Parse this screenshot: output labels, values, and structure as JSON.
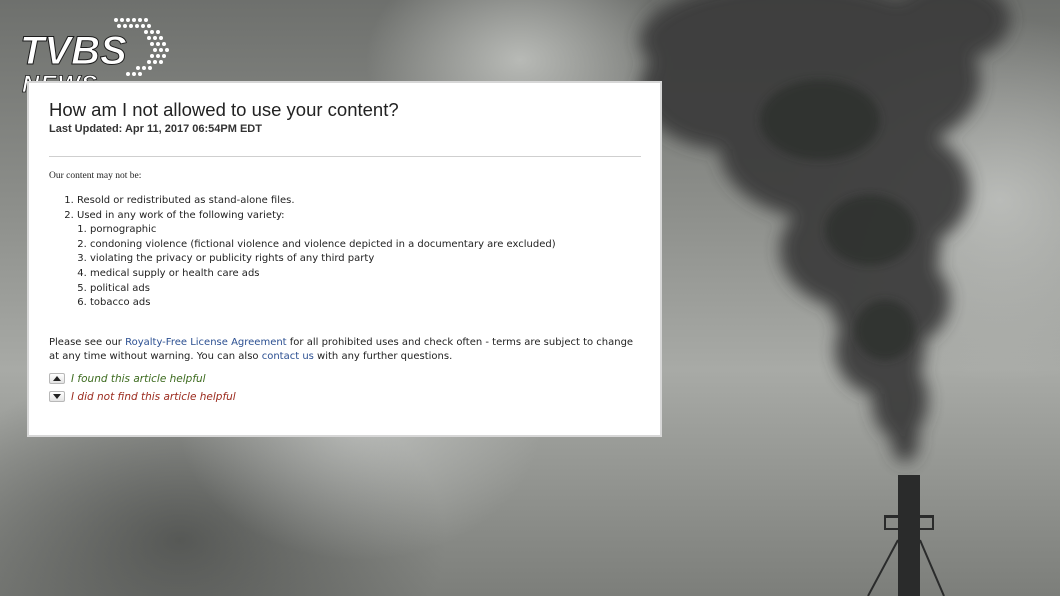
{
  "watermark": {
    "logo_text": "TVBS",
    "logo_subtext": "NEWS"
  },
  "article": {
    "title": "How am I not allowed to use your content?",
    "last_updated": "Last Updated: Apr 11, 2017 06:54PM EDT",
    "intro": "Our content may not be:",
    "items": [
      {
        "label": "Resold or redistributed as stand-alone files."
      },
      {
        "label": "Used in any work of the following variety:",
        "subitems": [
          "pornographic",
          "condoning violence (fictional violence and violence depicted in a documentary are excluded)",
          "violating the privacy or publicity rights of any third party",
          "medical supply or health care ads",
          "political ads",
          "tobacco ads"
        ]
      }
    ],
    "paragraph": {
      "before_link": "Please see our ",
      "license_link": "Royalty-Free License Agreement",
      "after_link": " for all prohibited uses and check often - terms are subject to change at any time without warning. You can also ",
      "contact_link": "contact us",
      "end": " with any further questions."
    },
    "feedback": {
      "helpful": "I found this article helpful",
      "not_helpful": "I did not find this article helpful"
    }
  },
  "colors": {
    "helpful": "#3d6b1f",
    "not_helpful": "#9b2a1d",
    "link": "#2b4f91"
  }
}
